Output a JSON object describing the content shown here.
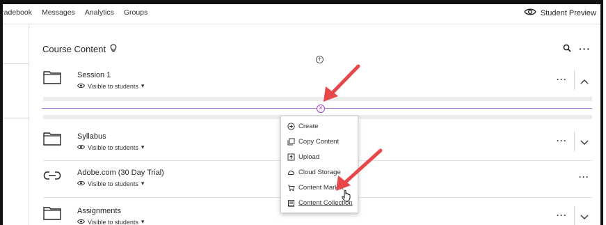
{
  "nav": {
    "tabs": [
      "Gradebook",
      "Messages",
      "Analytics",
      "Groups"
    ],
    "student_preview": "Student Preview"
  },
  "course_content": {
    "title": "Course Content"
  },
  "items": [
    {
      "title": "Session 1",
      "visibility": "Visible to students",
      "icon": "folder-icon",
      "expanded": true
    },
    {
      "title": "Syllabus",
      "visibility": "Visible to students",
      "icon": "folder-icon",
      "expanded": false
    },
    {
      "title": "Adobe.com (30 Day Trial)",
      "visibility": "Visible to students",
      "icon": "link-icon",
      "expanded": false
    },
    {
      "title": "Assignments",
      "visibility": "Visible to students",
      "icon": "folder-icon",
      "expanded": false
    }
  ],
  "menu": {
    "items": [
      {
        "label": "Create",
        "icon": "plus-circle-icon"
      },
      {
        "label": "Copy Content",
        "icon": "copy-icon"
      },
      {
        "label": "Upload",
        "icon": "upload-icon"
      },
      {
        "label": "Cloud Storage",
        "icon": "cloud-icon"
      },
      {
        "label": "Content Market",
        "icon": "market-icon"
      },
      {
        "label": "Content Collection",
        "icon": "collection-icon"
      }
    ]
  },
  "colors": {
    "accent_purple": "#a040c8",
    "annotation_arrow": "#e8474a"
  }
}
